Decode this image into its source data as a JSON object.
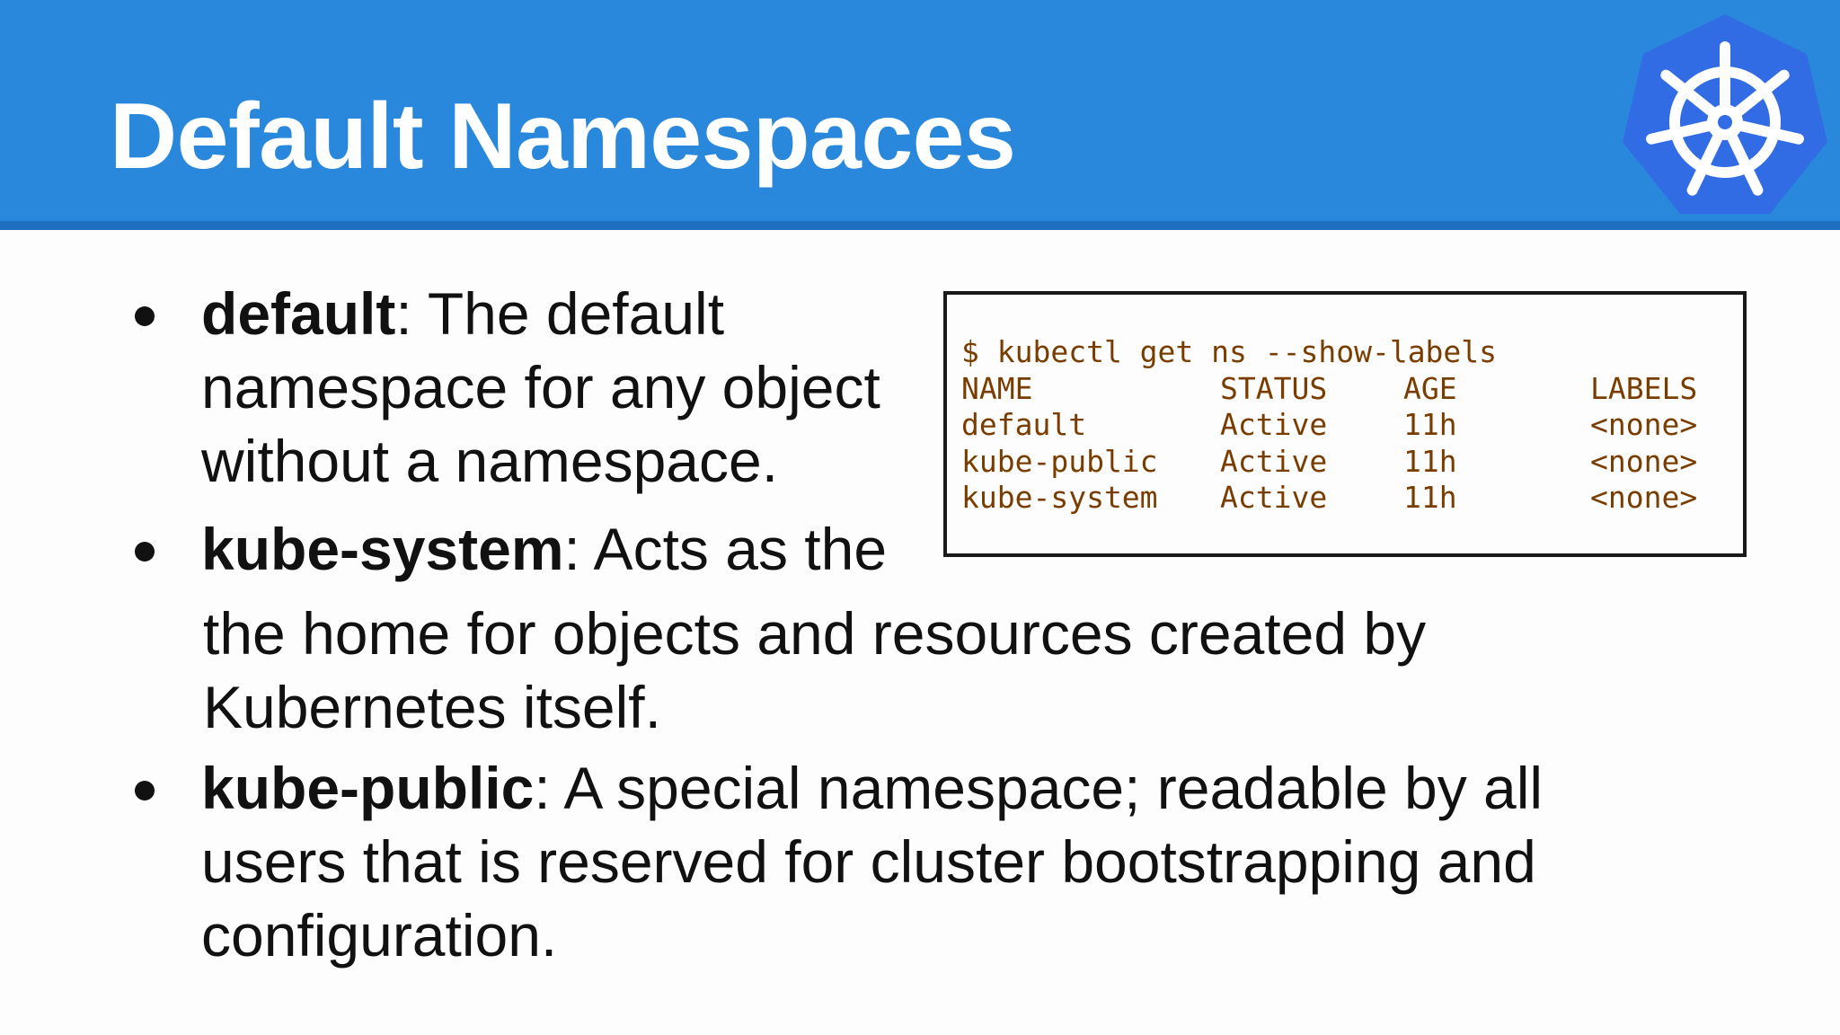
{
  "slide": {
    "title": "Default Namespaces",
    "colors": {
      "header": "#2a88dc",
      "header_rule": "#1e6fbf",
      "logo": "#326ce5",
      "terminal_text": "#7a3d00"
    },
    "logo_icon": "kubernetes-helm-wheel-icon"
  },
  "bullets": [
    {
      "term": "default",
      "sep": ":",
      "text": " The default namespace for any object without a namespace."
    },
    {
      "term": "kube-system",
      "sep": ":",
      "text_line1": " Acts as the",
      "text_rest": "the home for objects and resources created by Kubernetes itself."
    },
    {
      "term": "kube-public",
      "sep": ":",
      "text": " A special namespace; readable by all users that is reserved for cluster bootstrapping and configuration."
    }
  ],
  "terminal": {
    "command": "$ kubectl get ns --show-labels",
    "headers": [
      "NAME",
      "STATUS",
      "AGE",
      "LABELS"
    ],
    "rows": [
      [
        "default",
        "Active",
        "11h",
        "<none>"
      ],
      [
        "kube-public",
        "Active",
        "11h",
        "<none>"
      ],
      [
        "kube-system",
        "Active",
        "11h",
        "<none>"
      ]
    ]
  }
}
